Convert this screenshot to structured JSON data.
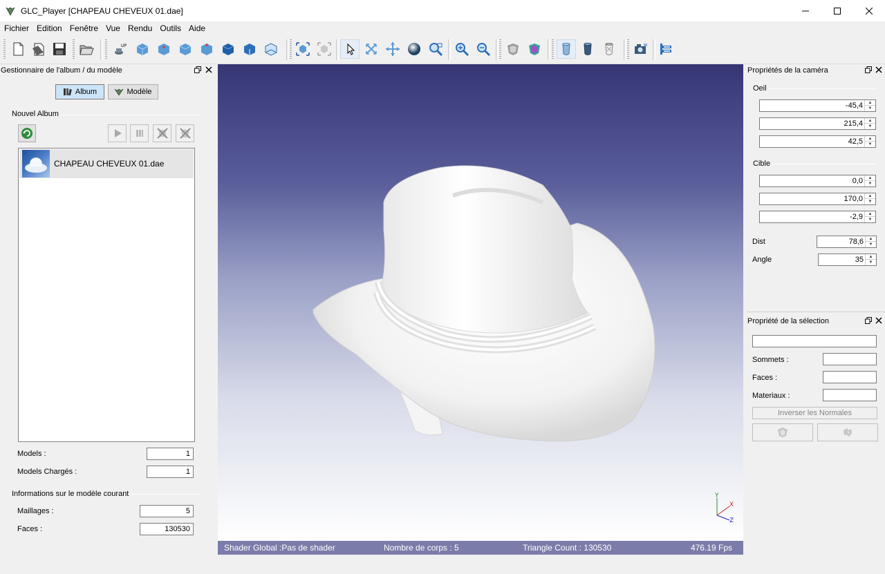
{
  "window": {
    "title": "GLC_Player [CHAPEAU CHEVEUX 01.dae]"
  },
  "menu": [
    "Fichier",
    "Edition",
    "Fenêtre",
    "Vue",
    "Rendu",
    "Outils",
    "Aide"
  ],
  "toolbar": {
    "icons": [
      "new-document-icon",
      "open-file-icon",
      "save-icon",
      "open-album-icon",
      "up-vector-icon",
      "view-iso-icon",
      "view-front-icon",
      "view-right-icon",
      "view-top-icon",
      "view-back-icon",
      "view-left-icon",
      "view-bottom-icon",
      "fit-all-icon",
      "fit-selection-icon",
      "select-arrow-icon",
      "rotate-icon",
      "pan-icon",
      "orbit-icon",
      "zoom-window-icon",
      "zoom-in-icon",
      "zoom-out-icon",
      "render-shaded-icon",
      "render-color-icon",
      "shade-solid-icon",
      "shade-wire-icon",
      "shade-transparent-icon",
      "screenshot-icon",
      "properties-icon"
    ]
  },
  "left_panel": {
    "title": "Gestionnaire de l'album / du modèle",
    "tab_album": "Album",
    "tab_model": "Modèle",
    "album_group": "Nouvel Album",
    "album_items": [
      {
        "name": "CHAPEAU CHEVEUX 01.dae"
      }
    ],
    "models_label": "Models :",
    "models_value": "1",
    "models_loaded_label": "Models Chargés :",
    "models_loaded_value": "1",
    "current_model_group": "Informations sur le modèle courant",
    "meshes_label": "Maillages :",
    "meshes_value": "5",
    "faces_label": "Faces :",
    "faces_value": "130530"
  },
  "camera_panel": {
    "title": "Propriétés de la caméra",
    "eye_group": "Oeil",
    "eye_x": "-45,4",
    "eye_y": "215,4",
    "eye_z": "42,5",
    "target_group": "Cible",
    "target_x": "0,0",
    "target_y": "170,0",
    "target_z": "-2,9",
    "dist_label": "Dist",
    "dist_value": "78,6",
    "angle_label": "Angle",
    "angle_value": "35"
  },
  "selection_panel": {
    "title": "Propriété de la sélection",
    "name_value": "",
    "vertices_label": "Sommets :",
    "vertices_value": "",
    "faces_label": "Faces :",
    "faces_value": "",
    "materials_label": "Materiaux :",
    "materials_value": "",
    "invert_normals_label": "Inverser les Normales"
  },
  "viewport": {
    "axis_x": "X",
    "axis_y": "Y",
    "axis_z": "Z",
    "colors": {
      "background_top": "#363675",
      "background_bottom": "#ffffff",
      "model": "#f4f4f4"
    }
  },
  "status": {
    "shader": "Shader Global :Pas de shader",
    "bodies": "Nombre de corps : 5",
    "triangles": "Triangle Count : 130530",
    "fps": "476.19 Fps"
  }
}
